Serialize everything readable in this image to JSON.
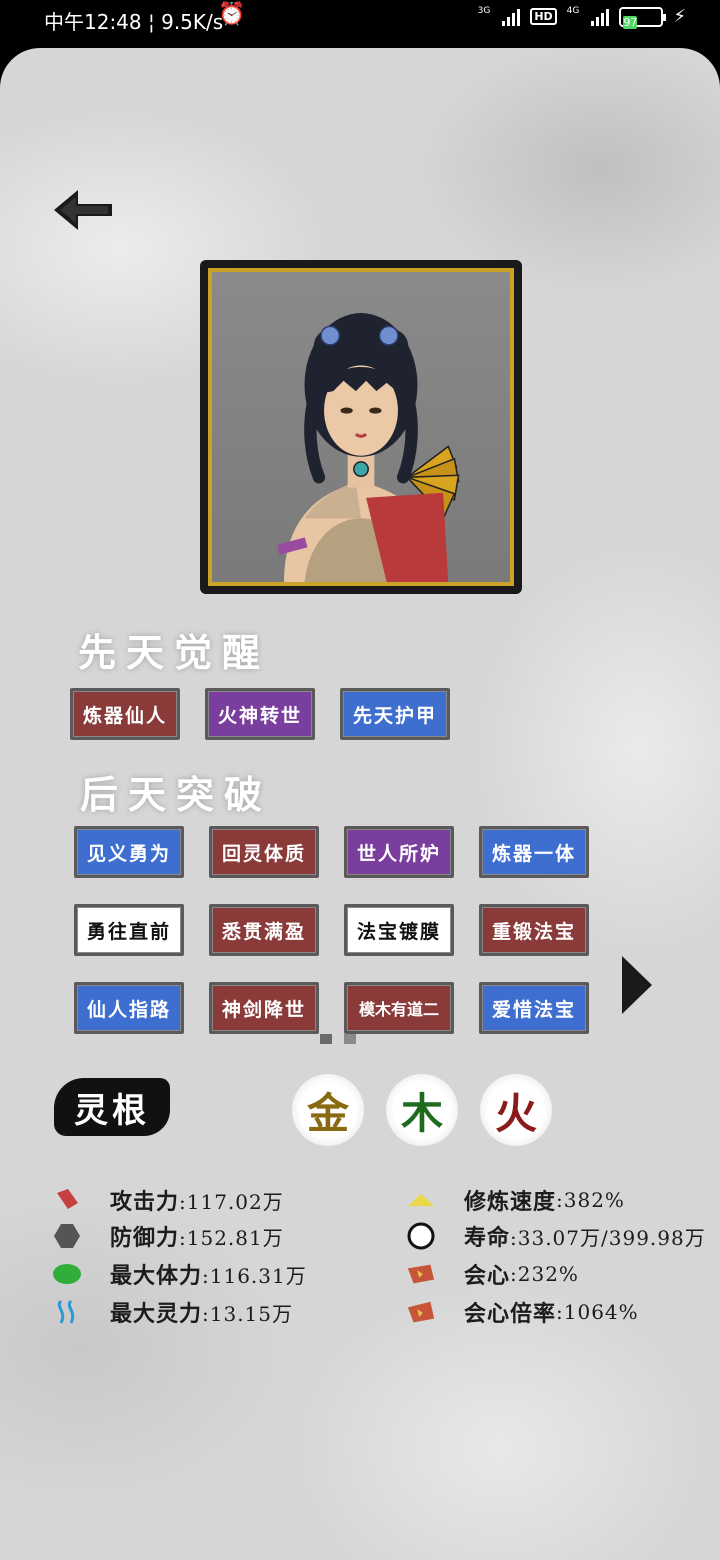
{
  "status": {
    "time": "中午12:48",
    "speed": "9.5K/s",
    "sig1": "3G",
    "sig2": "4G",
    "hd": "HD",
    "battery": "97"
  },
  "sections": {
    "innate": "先天觉醒",
    "acquired": "后天突破",
    "roots": "灵根"
  },
  "innate_tags": [
    {
      "label": "炼器仙人",
      "color": "red"
    },
    {
      "label": "火神转世",
      "color": "purple"
    },
    {
      "label": "先天护甲",
      "color": "blue"
    }
  ],
  "acquired_tags": [
    {
      "label": "见义勇为",
      "color": "blue"
    },
    {
      "label": "回灵体质",
      "color": "red"
    },
    {
      "label": "世人所妒",
      "color": "purple"
    },
    {
      "label": "炼器一体",
      "color": "blue"
    },
    {
      "label": "勇往直前",
      "color": "white"
    },
    {
      "label": "悉贯满盈",
      "color": "red"
    },
    {
      "label": "法宝镀膜",
      "color": "white"
    },
    {
      "label": "重锻法宝",
      "color": "red"
    },
    {
      "label": "仙人指路",
      "color": "blue"
    },
    {
      "label": "神剑降世",
      "color": "red"
    },
    {
      "label": "模木有道二",
      "color": "red"
    },
    {
      "label": "爱惜法宝",
      "color": "blue"
    }
  ],
  "elements": [
    {
      "label": "金",
      "color": "#8a6a10"
    },
    {
      "label": "木",
      "color": "#1e6b1e"
    },
    {
      "label": "火",
      "color": "#8b1a1a"
    }
  ],
  "stats_left": [
    {
      "name": "攻击力",
      "value": ":117.02万",
      "icon": "attack-icon"
    },
    {
      "name": "防御力",
      "value": ":152.81万",
      "icon": "defense-icon"
    },
    {
      "name": "最大体力",
      "value": ":116.31万",
      "icon": "health-icon"
    },
    {
      "name": "最大灵力",
      "value": ":13.15万",
      "icon": "spirit-icon"
    }
  ],
  "stats_right": [
    {
      "name": "修炼速度",
      "value": ":382%",
      "icon": "cultivation-icon"
    },
    {
      "name": "寿命",
      "value": ":33.07万/399.98万",
      "icon": "lifespan-icon"
    },
    {
      "name": "会心",
      "value": ":232%",
      "icon": "crit-icon"
    },
    {
      "name": "会心倍率",
      "value": ":1064%",
      "icon": "crit-rate-icon"
    }
  ]
}
